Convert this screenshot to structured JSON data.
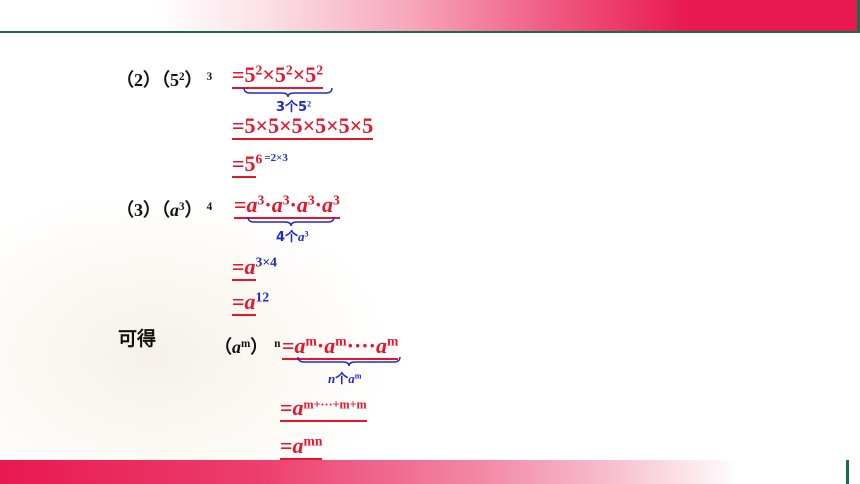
{
  "rows": {
    "r2": {
      "label_left": "（2）（5",
      "label_sup": "2",
      "label_right": "）",
      "label_outer_sup": "3",
      "eq1": "=5",
      "eq1_p1": "2",
      "eq1_m1": "×5",
      "eq1_p2": "2",
      "eq1_m2": "×5",
      "eq1_p3": "2",
      "brace_text": "3个5",
      "brace_sup": "2",
      "eq2": "=5×5×5×5×5×5",
      "eq3_base": "=5",
      "eq3_exp": "6",
      "eq3_note": "=2×3"
    },
    "r3": {
      "label_left": "（3）（",
      "label_var": "a",
      "label_sup": "3",
      "label_right": "）",
      "label_outer_sup": "4",
      "eq1_pre": "=",
      "term": "a",
      "term_exp": "3",
      "dot": "·",
      "brace_text": "4个",
      "brace_var": "a",
      "brace_sup": "3",
      "eq2_base": "=",
      "eq2_var": "a",
      "eq2_exp": "3×4",
      "eq3_base": "=",
      "eq3_var": "a",
      "eq3_exp": "12"
    },
    "general": {
      "kede": "可得",
      "label_open": "（",
      "label_var": "a",
      "label_sup": "m",
      "label_close": "）",
      "label_outer_sup": "n",
      "eq1_pre": "=",
      "term": "a",
      "term_exp": "m",
      "dot": "·",
      "dots": "····",
      "brace_text_n": "n",
      "brace_text": "个",
      "brace_var": "a",
      "brace_sup": "m",
      "eq2_pre": "=",
      "eq2_var": "a",
      "eq2_exp": "m+···+m+m",
      "eq3_pre": "=",
      "eq3_var": "a",
      "eq3_exp": "mn"
    }
  }
}
